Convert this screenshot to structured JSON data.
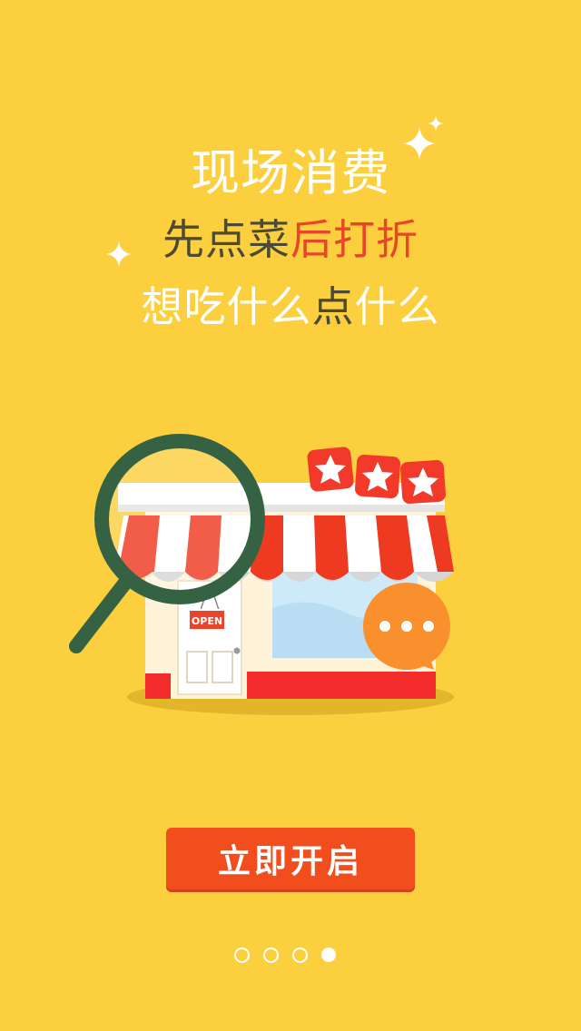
{
  "hero": {
    "title": "现场消费",
    "line2_part1": "先点菜",
    "line2_part2": "后打折",
    "line3_part1": "想吃",
    "line3_part2": "什么",
    "line3_part3": "点",
    "line3_part4": "什么"
  },
  "illustration": {
    "door_sign": "OPEN",
    "rating_stars": 3
  },
  "cta": {
    "label": "立即开启"
  },
  "pagination": {
    "total": 4,
    "active_index": 3
  },
  "colors": {
    "background": "#FCCF3F",
    "accent_red": "#E8452A",
    "button": "#F24D1C",
    "dark_text": "#4A4A36"
  }
}
